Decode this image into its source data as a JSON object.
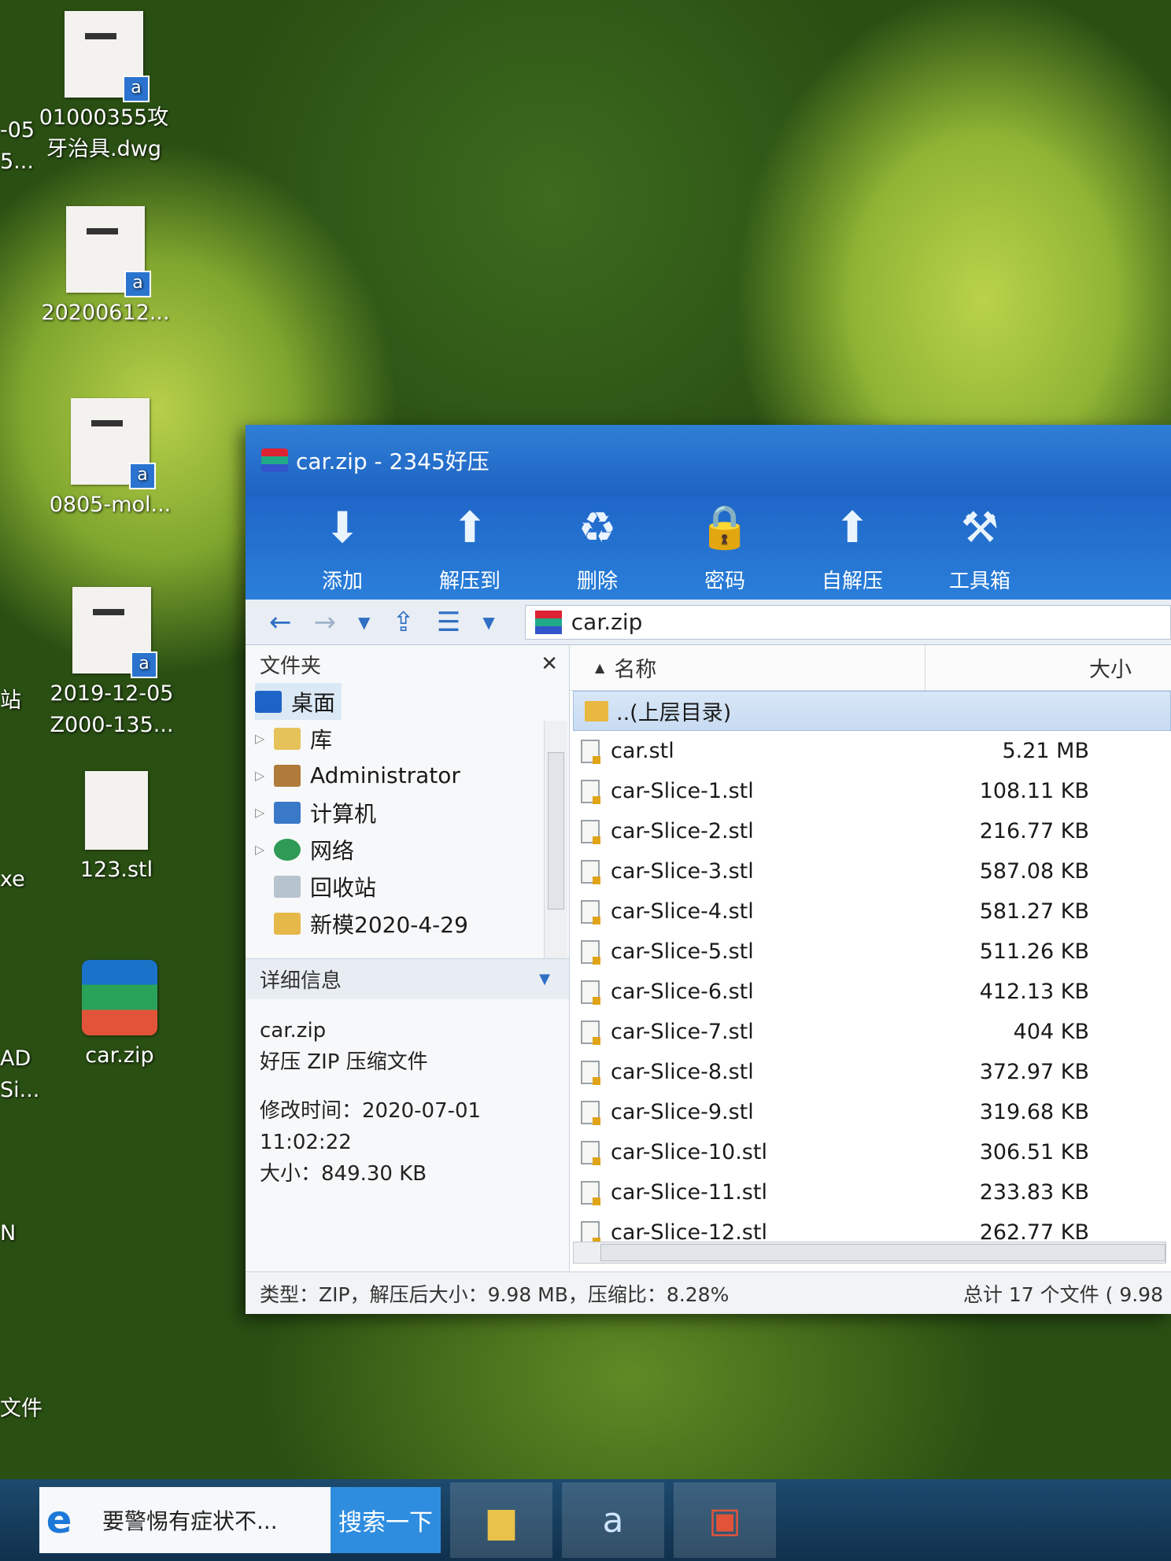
{
  "desktop": {
    "icons": [
      {
        "label_1": "01000355攻",
        "label_2": "牙治具.dwg"
      },
      {
        "label_1": "20200612...",
        "label_2": ""
      },
      {
        "label_1": "0805-mol...",
        "label_2": ""
      },
      {
        "label_1": "2019-12-05",
        "label_2": "Z000-135..."
      },
      {
        "label_1": "123.stl",
        "label_2": ""
      },
      {
        "label_1": "car.zip",
        "label_2": ""
      }
    ],
    "partial_labels": [
      "-05",
      "5...",
      "站",
      "xe",
      "AD",
      "Si...",
      "N",
      "文件"
    ]
  },
  "window": {
    "title": "car.zip - 2345好压",
    "toolbar": [
      {
        "label": "添加",
        "icon": "add-archive-icon",
        "glyph": "⬇"
      },
      {
        "label": "解压到",
        "icon": "extract-icon",
        "glyph": "⬆"
      },
      {
        "label": "删除",
        "icon": "recycle-bin-icon",
        "glyph": "♻"
      },
      {
        "label": "密码",
        "icon": "lock-icon",
        "glyph": "🔒"
      },
      {
        "label": "自解压",
        "icon": "self-extract-icon",
        "glyph": "⬆"
      },
      {
        "label": "工具箱",
        "icon": "toolbox-icon",
        "glyph": "⚒"
      }
    ],
    "address": "car.zip",
    "folders_pane": {
      "title": "文件夹",
      "items": [
        "桌面",
        "库",
        "Administrator",
        "计算机",
        "网络",
        "回收站",
        "新模2020-4-29"
      ]
    },
    "details_pane": {
      "title": "详细信息",
      "name": "car.zip",
      "type": "好压 ZIP 压缩文件",
      "modified_1": "修改时间：2020-07-01",
      "modified_2": "11:02:22",
      "size": "大小：849.30 KB"
    },
    "columns": {
      "name": "名称",
      "size": "大小"
    },
    "up_dir": "..(上层目录)",
    "files": [
      {
        "name": "car.stl",
        "size": "5.21 MB"
      },
      {
        "name": "car-Slice-1.stl",
        "size": "108.11 KB"
      },
      {
        "name": "car-Slice-2.stl",
        "size": "216.77 KB"
      },
      {
        "name": "car-Slice-3.stl",
        "size": "587.08 KB"
      },
      {
        "name": "car-Slice-4.stl",
        "size": "581.27 KB"
      },
      {
        "name": "car-Slice-5.stl",
        "size": "511.26 KB"
      },
      {
        "name": "car-Slice-6.stl",
        "size": "412.13 KB"
      },
      {
        "name": "car-Slice-7.stl",
        "size": "404 KB"
      },
      {
        "name": "car-Slice-8.stl",
        "size": "372.97 KB"
      },
      {
        "name": "car-Slice-9.stl",
        "size": "319.68 KB"
      },
      {
        "name": "car-Slice-10.stl",
        "size": "306.51 KB"
      },
      {
        "name": "car-Slice-11.stl",
        "size": "233.83 KB"
      },
      {
        "name": "car-Slice-12.stl",
        "size": "262.77 KB"
      }
    ],
    "status_left": "类型：ZIP，解压后大小：9.98 MB，压缩比：8.28%",
    "status_right": "总计 17 个文件 ( 9.98"
  },
  "taskbar": {
    "news_text": "要警惕有症状不...",
    "search_label": "搜索一下"
  }
}
